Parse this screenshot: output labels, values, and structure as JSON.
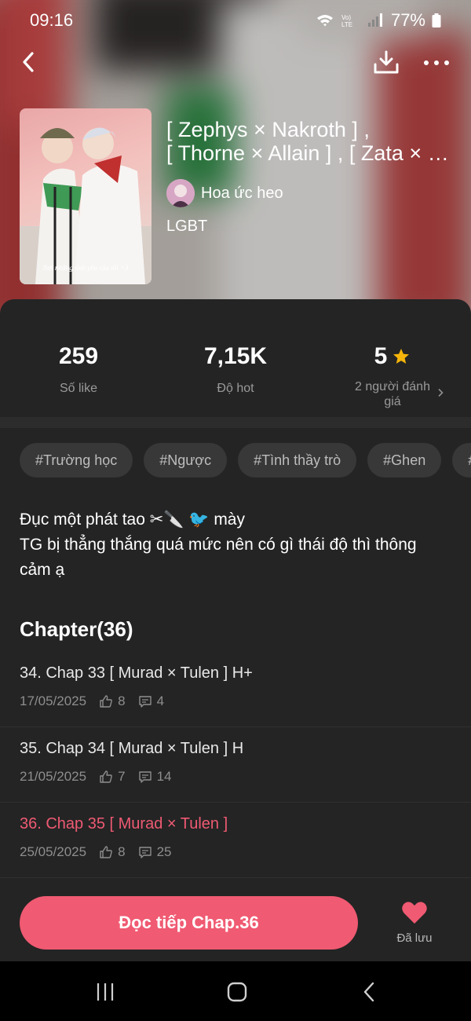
{
  "status_bar": {
    "time": "09:16",
    "battery": "77%"
  },
  "book": {
    "title_line1": "[ Zephys × Nakroth ] ,",
    "title_line2": "[ Thorne × Allain ] , [ Zata × …",
    "author": "Hoa ức heo",
    "genre": "LGBT",
    "cover_caption": "Nơi những tình yêu của tôi =3"
  },
  "stats": {
    "likes_value": "259",
    "likes_label": "Số like",
    "hot_value": "7,15K",
    "hot_label": "Độ hot",
    "rating_value": "5",
    "rating_label": "2 người đánh giá"
  },
  "tags": [
    "#Trường học",
    "#Ngược",
    "#Tình thầy trò",
    "#Ghen",
    "#C"
  ],
  "description": {
    "line1": "Đục một phát tao ✂🔪 🐦 mày",
    "line2": "TG bị thẳng thắng quá mức nên có gì thái độ thì thông cảm ạ"
  },
  "chapter_header": "Chapter(36)",
  "chapters": [
    {
      "title": "34. Chap 33 [ Murad × Tulen ] H+",
      "date": "17/05/2025",
      "likes": "8",
      "comments": "4"
    },
    {
      "title": "35. Chap 34 [ Murad × Tulen ] H",
      "date": "21/05/2025",
      "likes": "7",
      "comments": "14"
    },
    {
      "title": "36. Chap 35 [ Murad × Tulen ]",
      "date": "25/05/2025",
      "likes": "8",
      "comments": "25",
      "current": true
    }
  ],
  "actions": {
    "continue_label": "Đọc tiếp Chap.36",
    "saved_label": "Đã lưu"
  },
  "colors": {
    "accent": "#f05a72",
    "panel": "#242424",
    "star": "#f5b50a"
  },
  "icons": [
    "back-icon",
    "download-icon",
    "more-icon",
    "star-icon",
    "chevron-right-icon",
    "thumb-up-icon",
    "comment-icon",
    "heart-icon",
    "recent-apps-icon",
    "home-icon",
    "nav-back-icon"
  ]
}
